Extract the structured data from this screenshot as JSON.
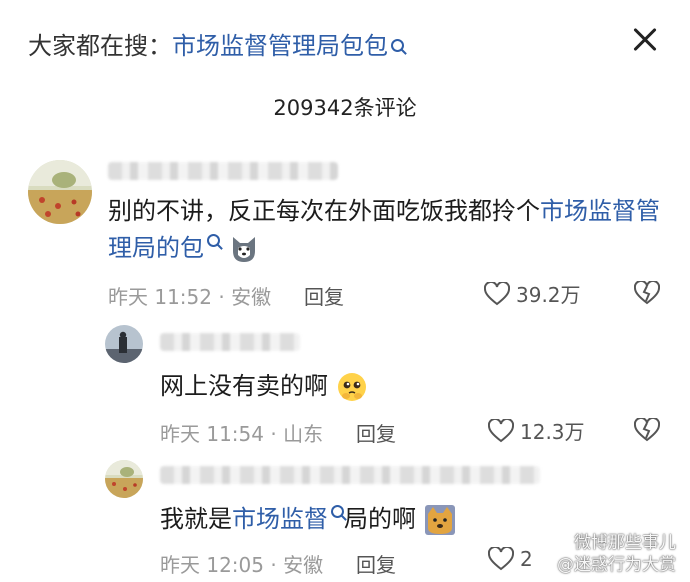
{
  "search": {
    "prefix": "大家都在搜：",
    "query": "市场监督管理局包包"
  },
  "comment_count": "209342条评论",
  "comments": [
    {
      "text_before": "别的不讲，反正每次在外面吃饭我都拎个",
      "link": "市场监督管理局的包",
      "time": "昨天 11:52 · 安徽",
      "reply_label": "回复",
      "likes": "39.2万"
    },
    {
      "text_before": "网上没有卖的啊",
      "time": "昨天 11:54 · 山东",
      "reply_label": "回复",
      "likes": "12.3万"
    },
    {
      "text_before": "我就是",
      "link": "市场监督",
      "text_after": "局的啊",
      "time": "昨天 12:05 · 安徽",
      "reply_label": "回复",
      "likes": "2"
    }
  ],
  "watermark": {
    "line1": "微博那些事儿",
    "line2": "@迷惑行为大赏"
  },
  "colors": {
    "link": "#2f5ea8",
    "meta": "#9a9a9a"
  },
  "icons": [
    "close-icon",
    "search-icon",
    "heart-icon",
    "broken-heart-icon"
  ]
}
